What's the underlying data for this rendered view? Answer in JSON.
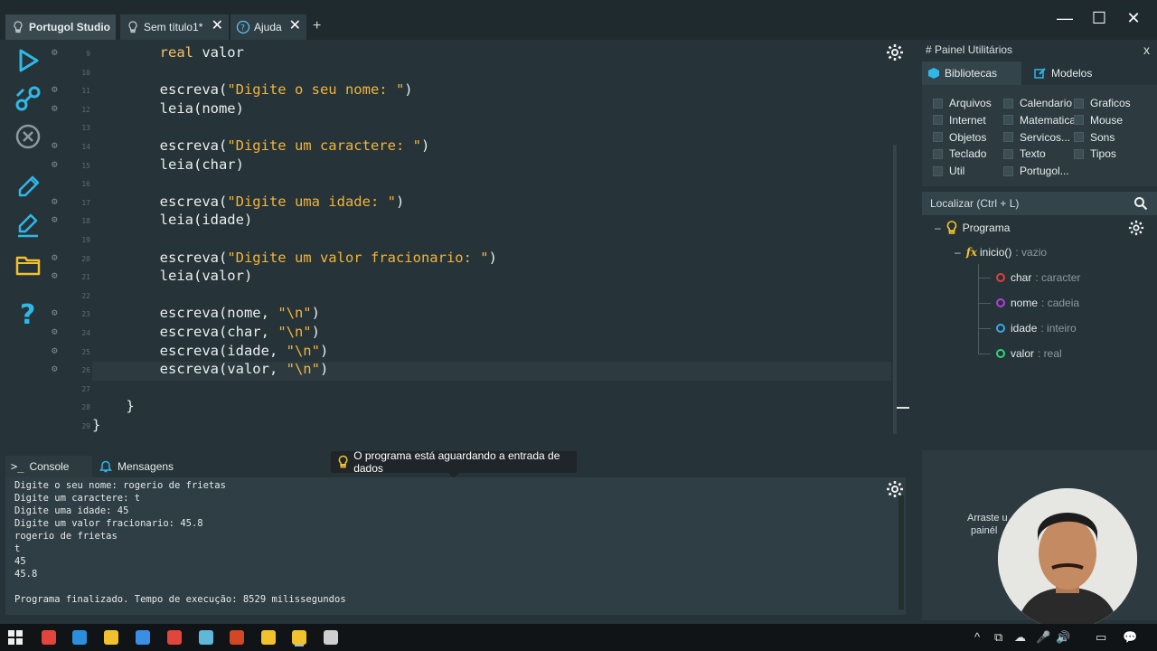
{
  "window": {
    "tabs": [
      {
        "label": "Portugol Studio"
      },
      {
        "label": "Sem título1*"
      },
      {
        "label": "Ajuda"
      }
    ],
    "add_tab": "+",
    "close_symbol": "✕",
    "minimize": "—",
    "maximize": "☐",
    "close": "✕"
  },
  "toolbar": {
    "icons": [
      "run-icon",
      "debug-step-icon",
      "stop-icon",
      "save-icon",
      "save-as-icon",
      "open-folder-icon",
      "help-icon"
    ],
    "colors": {
      "accent": "#2fb8e8",
      "run": "#2fb8e8",
      "stop": "#8c9ba0",
      "folder": "#f2c12e"
    }
  },
  "editor": {
    "gutter": [
      {
        "num": "9",
        "bug": true
      },
      {
        "num": "10",
        "bug": false
      },
      {
        "num": "11",
        "bug": true
      },
      {
        "num": "12",
        "bug": true
      },
      {
        "num": "13",
        "bug": false
      },
      {
        "num": "14",
        "bug": true
      },
      {
        "num": "15",
        "bug": true
      },
      {
        "num": "16",
        "bug": false
      },
      {
        "num": "17",
        "bug": true
      },
      {
        "num": "18",
        "bug": true
      },
      {
        "num": "19",
        "bug": false
      },
      {
        "num": "20",
        "bug": true
      },
      {
        "num": "21",
        "bug": true
      },
      {
        "num": "22",
        "bug": false
      },
      {
        "num": "23",
        "bug": true
      },
      {
        "num": "24",
        "bug": true
      },
      {
        "num": "25",
        "bug": true
      },
      {
        "num": "26",
        "bug": true
      },
      {
        "num": "27",
        "bug": false
      },
      {
        "num": "28",
        "bug": false
      },
      {
        "num": "29",
        "bug": false
      }
    ],
    "lines": [
      "        real valor",
      "",
      "        escreva(\"Digite o seu nome: \")",
      "        leia(nome)",
      "",
      "        escreva(\"Digite um caractere: \")",
      "        leia(char)",
      "",
      "        escreva(\"Digite uma idade: \")",
      "        leia(idade)",
      "",
      "        escreva(\"Digite um valor fracionario: \")",
      "        leia(valor)",
      "",
      "        escreva(nome, \"\\n\")",
      "        escreva(char, \"\\n\")",
      "        escreva(idade, \"\\n\")",
      "        escreva(valor, \"\\n\")",
      "",
      "    }",
      "}"
    ]
  },
  "utilities_panel": {
    "title": "# Painel Utilitários",
    "close": "x",
    "tabs": [
      "Bibliotecas",
      "Modelos"
    ],
    "libraries": [
      [
        "Arquivos",
        "Calendario",
        "Graficos"
      ],
      [
        "Internet",
        "Matematica",
        "Mouse"
      ],
      [
        "Objetos",
        "Servicos...",
        "Sons"
      ],
      [
        "Teclado",
        "Texto",
        "Tipos"
      ],
      [
        "Util",
        "Portugol...",
        ""
      ]
    ],
    "search_placeholder": "Localizar (Ctrl + L)",
    "tree": {
      "root": "Programa",
      "function": {
        "name": "inicio()",
        "type": ": vazio"
      },
      "variables": [
        {
          "name": "char",
          "type": ": caracter",
          "color": "#e04040"
        },
        {
          "name": "nome",
          "type": ": cadeia",
          "color": "#b040d8"
        },
        {
          "name": "idade",
          "type": ": inteiro",
          "color": "#3aa8e0"
        },
        {
          "name": "valor",
          "type": ": real",
          "color": "#2fd47a"
        }
      ]
    }
  },
  "console": {
    "tabs": [
      "Console",
      "Mensagens"
    ],
    "tooltip": "O programa está aguardando a entrada de dados",
    "output": [
      "Digite o seu nome: rogerio de frietas",
      "Digite um caractere: t",
      "Digite uma idade: 45",
      "Digite um valor fracionario: 45.8",
      "rogerio de frietas",
      "t",
      "45",
      "45.8",
      "",
      "Programa finalizado. Tempo de execução: 8529 milissegundos"
    ]
  },
  "side_placeholder": {
    "line1": "Arraste u",
    "line2": "painél"
  },
  "taskbar": {
    "apps": [
      "windows-start-icon",
      "chrome-icon",
      "edge-icon",
      "file-explorer-icon",
      "mail-icon",
      "chrome-icon",
      "notes-icon",
      "powerpoint-icon",
      "portugol-icon",
      "portugol-active-icon",
      "obs-icon"
    ],
    "tray": [
      "^",
      "⧉",
      "☁",
      "🎤",
      "🔊",
      "▭",
      "💬"
    ]
  }
}
